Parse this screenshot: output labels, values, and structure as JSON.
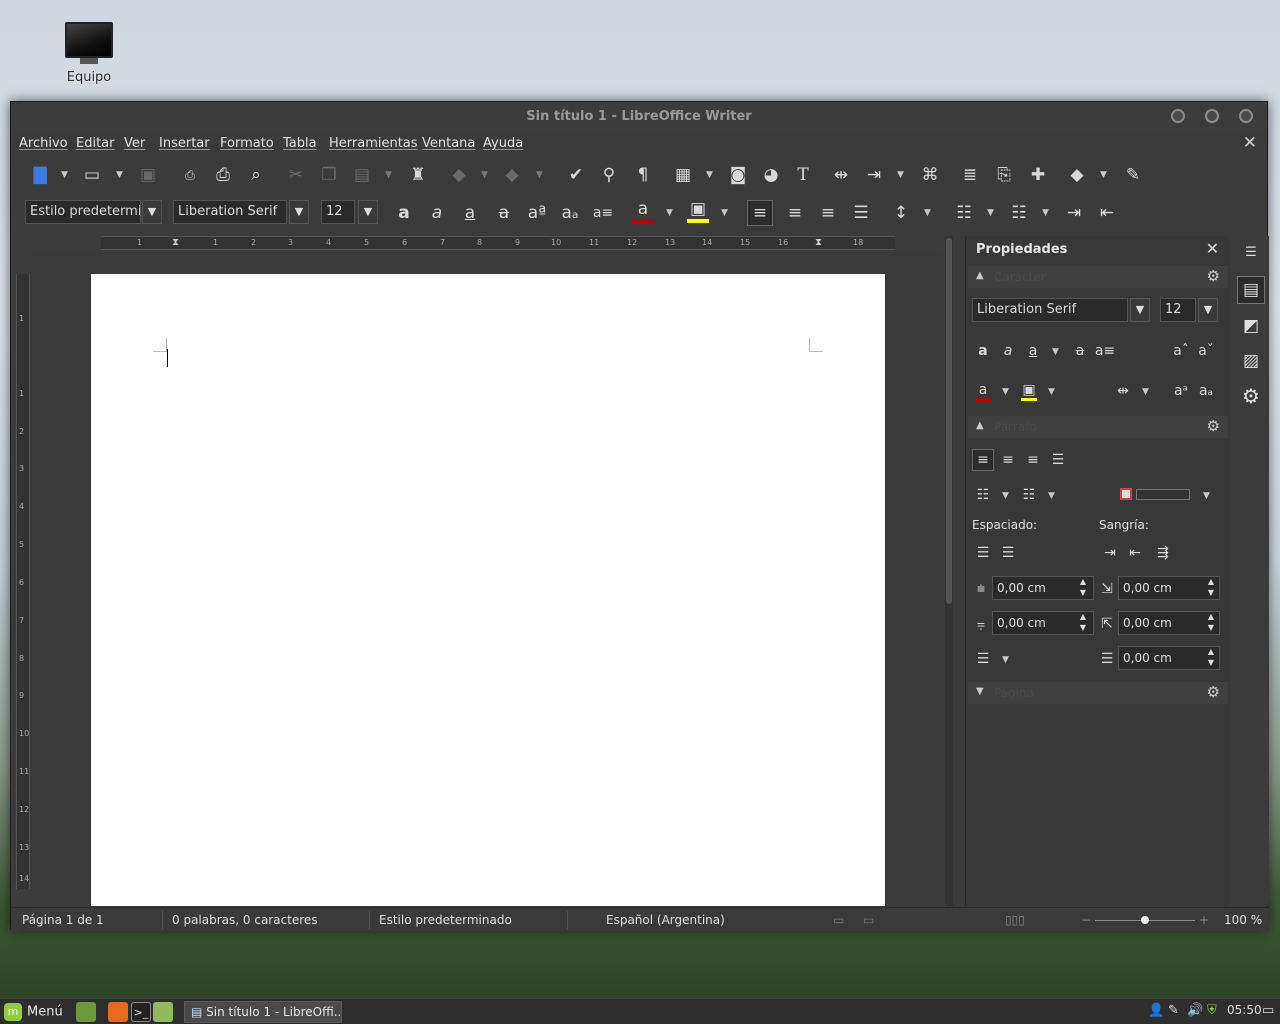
{
  "desktop": {
    "icon_label": "Equipo"
  },
  "window": {
    "title": "Sin título 1 - LibreOffice Writer"
  },
  "menu": [
    "Archivo",
    "Editar",
    "Ver",
    "Insertar",
    "Formato",
    "Tabla",
    "Herramientas",
    "Ventana",
    "Ayuda"
  ],
  "formatting": {
    "paragraph_style": "Estilo predetermina",
    "font_name": "Liberation Serif",
    "font_size": "12"
  },
  "ruler": {
    "h_numbers": [
      "1",
      "1",
      "2",
      "3",
      "4",
      "5",
      "6",
      "7",
      "8",
      "9",
      "10",
      "11",
      "12",
      "13",
      "14",
      "15",
      "16",
      "18"
    ],
    "v_numbers": [
      "1",
      "1",
      "2",
      "3",
      "4",
      "5",
      "6",
      "7",
      "8",
      "9",
      "10",
      "11",
      "12",
      "13",
      "14"
    ]
  },
  "sidebar": {
    "title": "Propiedades",
    "character_section": "Carácter",
    "font_name": "Liberation Serif",
    "font_size": "12",
    "paragraph_section": "Párrafo",
    "spacing_label": "Espaciado:",
    "indent_label": "Sangría:",
    "above_spacing": "0,00 cm",
    "below_spacing": "0,00 cm",
    "before_indent": "0,00 cm",
    "after_indent": "0,00 cm",
    "first_line_indent": "0,00 cm",
    "page_section": "Página"
  },
  "status": {
    "page": "Página 1 de 1",
    "words": "0 palabras, 0 caracteres",
    "style": "Estilo predeterminado",
    "language": "Español (Argentina)",
    "zoom": "100 %",
    "zoom_level": 0.5
  },
  "taskbar": {
    "menu_label": "Menú",
    "task_label": "Sin título 1 - LibreOffi...",
    "clock": "05:50"
  },
  "colors": {
    "font_color_bar": "#c00000",
    "highlight_bar": "#ffff00",
    "mint_accent": "#8fce3f"
  }
}
